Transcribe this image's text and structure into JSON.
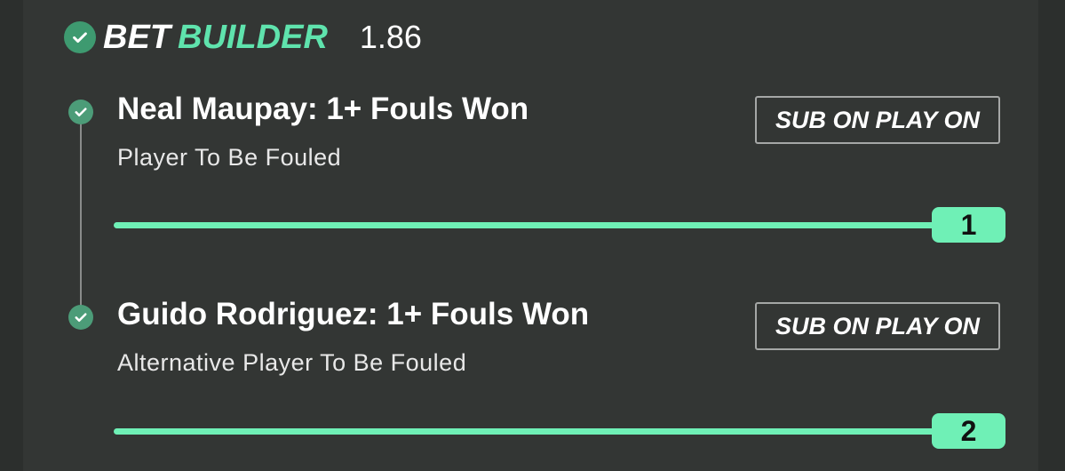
{
  "header": {
    "brand_word1": "BET",
    "brand_word2": "BUILDER",
    "odds": "1.86"
  },
  "legs": [
    {
      "title": "Neal Maupay: 1+ Fouls Won",
      "subtitle": "Player To Be Fouled",
      "button_label": "SUB ON PLAY ON",
      "leg_number": "1"
    },
    {
      "title": "Guido Rodriguez: 1+ Fouls Won",
      "subtitle": "Alternative Player To Be Fouled",
      "button_label": "SUB ON PLAY ON",
      "leg_number": "2"
    }
  ],
  "colors": {
    "accent": "#6ff0b6",
    "check": "#4c9c78",
    "background": "#333634"
  },
  "icons": {
    "header_check": "check-circle-icon",
    "leg_check": "check-circle-icon"
  }
}
